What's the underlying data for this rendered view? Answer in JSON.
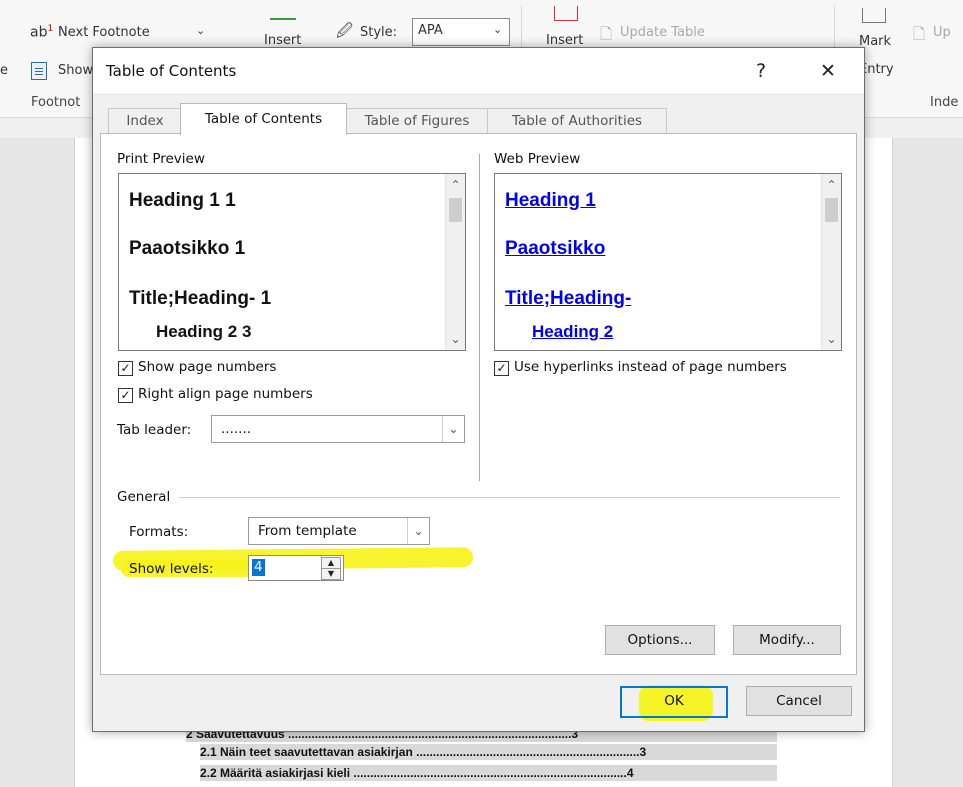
{
  "ribbon": {
    "next_footnote": "Next Footnote",
    "show_notes": "Show",
    "footnotes_group": "Footnot",
    "insert_citation": "Insert",
    "style_label": "Style:",
    "style_value": "APA",
    "insert_caption": "Insert",
    "update_table": "Update Table",
    "mark_entry_line1": "Mark",
    "mark_entry_line2": "Entry",
    "update_index": "Up",
    "index_group": "Inde",
    "left_edge": "e",
    "icon_footnote": "footnote-ab-icon",
    "icon_show": "show-notes-icon"
  },
  "document": {
    "toc": [
      {
        "text": "2    Saavutettavuus .....................................................................................3"
      },
      {
        "text": "2.1    Näin teet saavutettavan asiakirjan ...................................................................3"
      },
      {
        "text": "2.2    Määritä asiakirjasi kieli ..................................................................................4"
      }
    ]
  },
  "dialog": {
    "title": "Table of Contents",
    "help": "?",
    "close": "✕",
    "tabs": [
      {
        "label": "Index",
        "active": false
      },
      {
        "label": "Table of Contents",
        "active": true
      },
      {
        "label": "Table of Figures",
        "active": false
      },
      {
        "label": "Table of Authorities",
        "active": false
      }
    ],
    "print_preview": {
      "label": "Print Preview",
      "items": [
        "Heading 1 1",
        "Paaotsikko 1",
        "Title;Heading- 1",
        "Heading 2 3"
      ]
    },
    "web_preview": {
      "label": "Web Preview",
      "items": [
        "Heading 1",
        "Paaotsikko",
        "Title;Heading-",
        "Heading 2"
      ]
    },
    "show_page_numbers": {
      "label": "Show page numbers",
      "checked": true
    },
    "right_align": {
      "label": "Right align page numbers",
      "checked": true
    },
    "use_hyperlinks": {
      "label": "Use hyperlinks instead of page numbers",
      "checked": true
    },
    "tab_leader": {
      "label": "Tab leader:",
      "value": "......."
    },
    "general": {
      "label": "General",
      "formats_label": "Formats:",
      "formats_value": "From template",
      "show_levels_label": "Show levels:",
      "show_levels_value": "4"
    },
    "buttons": {
      "options": "Options...",
      "modify": "Modify...",
      "ok": "OK",
      "cancel": "Cancel"
    },
    "highlight_color": "#f6f21a",
    "link_color": "#0000ee",
    "accent_color": "#0078d7"
  }
}
